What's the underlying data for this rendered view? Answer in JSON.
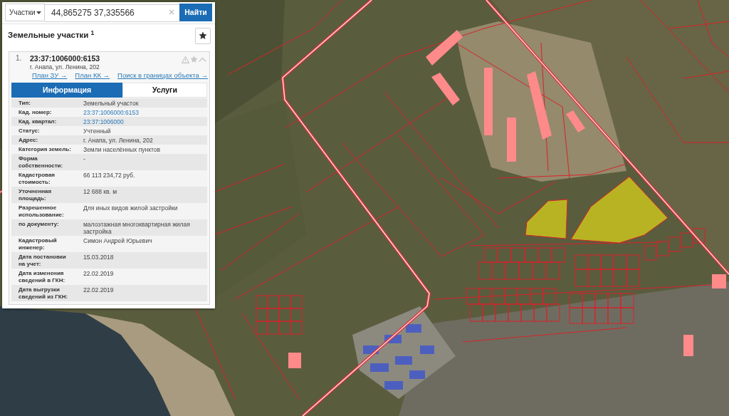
{
  "search": {
    "scope": "Участки",
    "value": "44,865275 37,335566",
    "button": "Найти"
  },
  "results": {
    "title": "Земельные участки $^{1}$"
  },
  "items": [
    {
      "index": "1.",
      "number": "23:37:1006000:6153",
      "address": "г. Анапа, ул. Ленина, 202",
      "expanded": true,
      "links": [
        "План ЗУ →",
        "План КК →",
        "Поиск в границах объекта →"
      ],
      "tabs": [
        {
          "label": "Информация",
          "selected": true
        },
        {
          "label": "Услуги",
          "selected": false
        }
      ],
      "rows": [
        {
          "label": "Тип:",
          "value": "Земельный участок",
          "kind": "text"
        },
        {
          "label": "Кад. номер:",
          "value": "23:37:1006000:6153",
          "kind": "link"
        },
        {
          "label": "Кад. квартал:",
          "value": "23:37:1006000",
          "kind": "link"
        },
        {
          "label": "Статус:",
          "value": "Учтенный",
          "kind": "text"
        },
        {
          "label": "Адрес:",
          "value": "г. Анапа, ул. Ленина, 202",
          "kind": "text"
        },
        {
          "label": "Категория земель:",
          "value": "Земли населённых пунктов",
          "kind": "text"
        },
        {
          "label": "Форма собственности:",
          "value": "-",
          "kind": "text"
        },
        {
          "label": "Кадастровая стоимость:",
          "value": "66 113 234,72 руб.",
          "kind": "text"
        },
        {
          "label": "Уточненная площадь:",
          "value": "12 688 кв. м",
          "kind": "text"
        },
        {
          "label": "Разрешенное использование:",
          "value": "Для иных видов жилой застройки",
          "kind": "text"
        },
        {
          "label": "по документу:",
          "value": "малоэтажная многоквартирная жилая застройка",
          "kind": "text"
        },
        {
          "label": "Кадастровый инженер:",
          "value": "Симон Андрей Юрьевич",
          "kind": "text"
        },
        {
          "label": "Дата постановки на учет:",
          "value": "15.03.2018",
          "kind": "text"
        },
        {
          "label": "Дата изменения сведений в ГКН:",
          "value": "22.02.2019",
          "kind": "text"
        },
        {
          "label": "Дата выгрузки сведений из ГКН:",
          "value": "22.02.2019",
          "kind": "text"
        }
      ]
    }
  ]
}
